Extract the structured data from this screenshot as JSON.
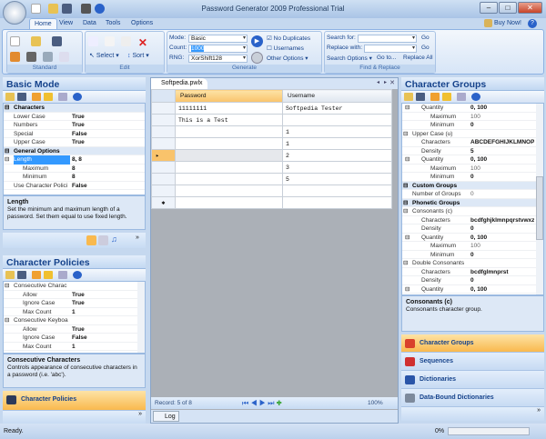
{
  "window": {
    "title": "Password Generator 2009 Professional Trial",
    "minimize": "–",
    "maximize": "□",
    "close": "✕"
  },
  "ribbon": {
    "tabs": [
      "Home",
      "View",
      "Data",
      "Tools",
      "Options"
    ],
    "buy_now": "Buy Now!",
    "help": "?",
    "groups": {
      "standard": "Standard",
      "edit": "Edit",
      "generate": "Generate",
      "find_replace": "Find & Replace"
    },
    "edit": {
      "select": "Select",
      "sort": "Sort"
    },
    "generate": {
      "mode_label": "Mode:",
      "mode_value": "Basic",
      "count_label": "Count:",
      "count_value": "1000",
      "rng_label": "RNG:",
      "rng_value": "XorShift128",
      "no_duplicates": "No Duplicates",
      "no_duplicates_checked": true,
      "usernames": "Usernames",
      "usernames_checked": false,
      "other_options": "Other Options"
    },
    "find": {
      "search_label": "Search for:",
      "search_value": "",
      "replace_label": "Replace with:",
      "replace_value": "",
      "go": "Go",
      "search_options": "Search Options",
      "go_to": "Go to...",
      "replace_all": "Replace All"
    }
  },
  "basic_mode": {
    "title": "Basic Mode",
    "rows": [
      {
        "type": "cat",
        "key": "Characters",
        "ex": "⊟"
      },
      {
        "key": "Lower Case",
        "value": "True"
      },
      {
        "key": "Numbers",
        "value": "True"
      },
      {
        "key": "Special",
        "value": "False"
      },
      {
        "key": "Upper Case",
        "value": "True"
      },
      {
        "type": "cat",
        "key": "General Options",
        "ex": "⊟"
      },
      {
        "type": "sel",
        "key": "Length",
        "value": "8, 8",
        "ex": "⊟"
      },
      {
        "key": "Maximum",
        "value": "8",
        "indent": true
      },
      {
        "key": "Minimum",
        "value": "8",
        "indent": true
      },
      {
        "key": "Use Character Polici",
        "value": "False"
      }
    ],
    "desc_title": "Length",
    "desc_text": "Set the minimum and maximum length of a password. Set them equal to use fixed length."
  },
  "character_policies": {
    "title": "Character Policies",
    "rows": [
      {
        "key": "Consecutive Charac",
        "ex": "⊟",
        "plain": true
      },
      {
        "key": "Allow",
        "value": "True",
        "indent": true
      },
      {
        "key": "Ignore Case",
        "value": "True",
        "indent": true
      },
      {
        "key": "Max Count",
        "value": "1",
        "indent": true
      },
      {
        "key": "Consecutive Keyboa",
        "ex": "⊟",
        "plain": true
      },
      {
        "key": "Allow",
        "value": "True",
        "indent": true
      },
      {
        "key": "Ignore Case",
        "value": "False",
        "indent": true
      },
      {
        "key": "Max Count",
        "value": "1",
        "indent": true
      }
    ],
    "desc_title": "Consecutive Characters",
    "desc_text": "Controls appearance of consecutive characters in a password (i.e. 'abc').",
    "nav_button": "Character Policies"
  },
  "document": {
    "tab": "Softpedia.pwlx",
    "columns": [
      "Password",
      "Username"
    ],
    "rows": [
      [
        "11111111",
        "Softpedia Tester"
      ],
      [
        "This is a Test",
        ""
      ],
      [
        "",
        "1"
      ],
      [
        "",
        "1"
      ],
      [
        "",
        "2"
      ],
      [
        "",
        "3"
      ],
      [
        "",
        "5"
      ],
      [
        "",
        ""
      ]
    ],
    "current_row": 4,
    "new_row_marker": "✱",
    "record": "Record: 5 of 8",
    "zoom": "100%",
    "log_tab": "Log"
  },
  "character_groups": {
    "title": "Character Groups",
    "rows": [
      {
        "key": "Quantity",
        "value": "0, 100",
        "ex": "⊟",
        "indent": 1
      },
      {
        "key": "Maximum",
        "value": "100",
        "indent": 2,
        "light": true
      },
      {
        "key": "Minimum",
        "value": "0",
        "indent": 2
      },
      {
        "key": "Upper Case (u)",
        "ex": "⊟",
        "plain": true
      },
      {
        "key": "Characters",
        "value": "ABCDEFGHIJKLMNOP",
        "indent": 1
      },
      {
        "key": "Density",
        "value": "5",
        "indent": 1
      },
      {
        "key": "Quantity",
        "value": "0, 100",
        "ex": "⊟",
        "indent": 1
      },
      {
        "key": "Maximum",
        "value": "100",
        "indent": 2,
        "light": true
      },
      {
        "key": "Minimum",
        "value": "0",
        "indent": 2
      },
      {
        "type": "cat",
        "key": "Custom Groups",
        "ex": "⊟"
      },
      {
        "key": "Number of Groups",
        "value": "0",
        "light": true
      },
      {
        "type": "cat",
        "key": "Phonetic Groups",
        "ex": "⊟"
      },
      {
        "key": "Consonants (c)",
        "ex": "⊟",
        "plain": true
      },
      {
        "key": "Characters",
        "value": "bcdfghjklmnpqrstvwxz",
        "indent": 1
      },
      {
        "key": "Density",
        "value": "0",
        "indent": 1
      },
      {
        "key": "Quantity",
        "value": "0, 100",
        "ex": "⊟",
        "indent": 1
      },
      {
        "key": "Maximum",
        "value": "100",
        "indent": 2,
        "light": true
      },
      {
        "key": "Minimum",
        "value": "0",
        "indent": 2
      },
      {
        "key": "Double Consonants",
        "ex": "⊟",
        "plain": true
      },
      {
        "key": "Characters",
        "value": "bcdfglmnprst",
        "indent": 1
      },
      {
        "key": "Density",
        "value": "0",
        "indent": 1
      },
      {
        "key": "Quantity",
        "value": "0, 100",
        "ex": "⊟",
        "indent": 1
      }
    ],
    "desc_title": "Consonants (c)",
    "desc_text": "Consonants character group.",
    "nav": [
      {
        "label": "Character Groups",
        "active": true,
        "color": "#d9412b"
      },
      {
        "label": "Sequences",
        "color": "#d03030"
      },
      {
        "label": "Dictionaries",
        "color": "#2a55a8"
      },
      {
        "label": "Data-Bound Dictionaries",
        "color": "#7d8a9c"
      }
    ]
  },
  "status": {
    "text": "Ready.",
    "progress_label": "0%",
    "progress": 0
  }
}
